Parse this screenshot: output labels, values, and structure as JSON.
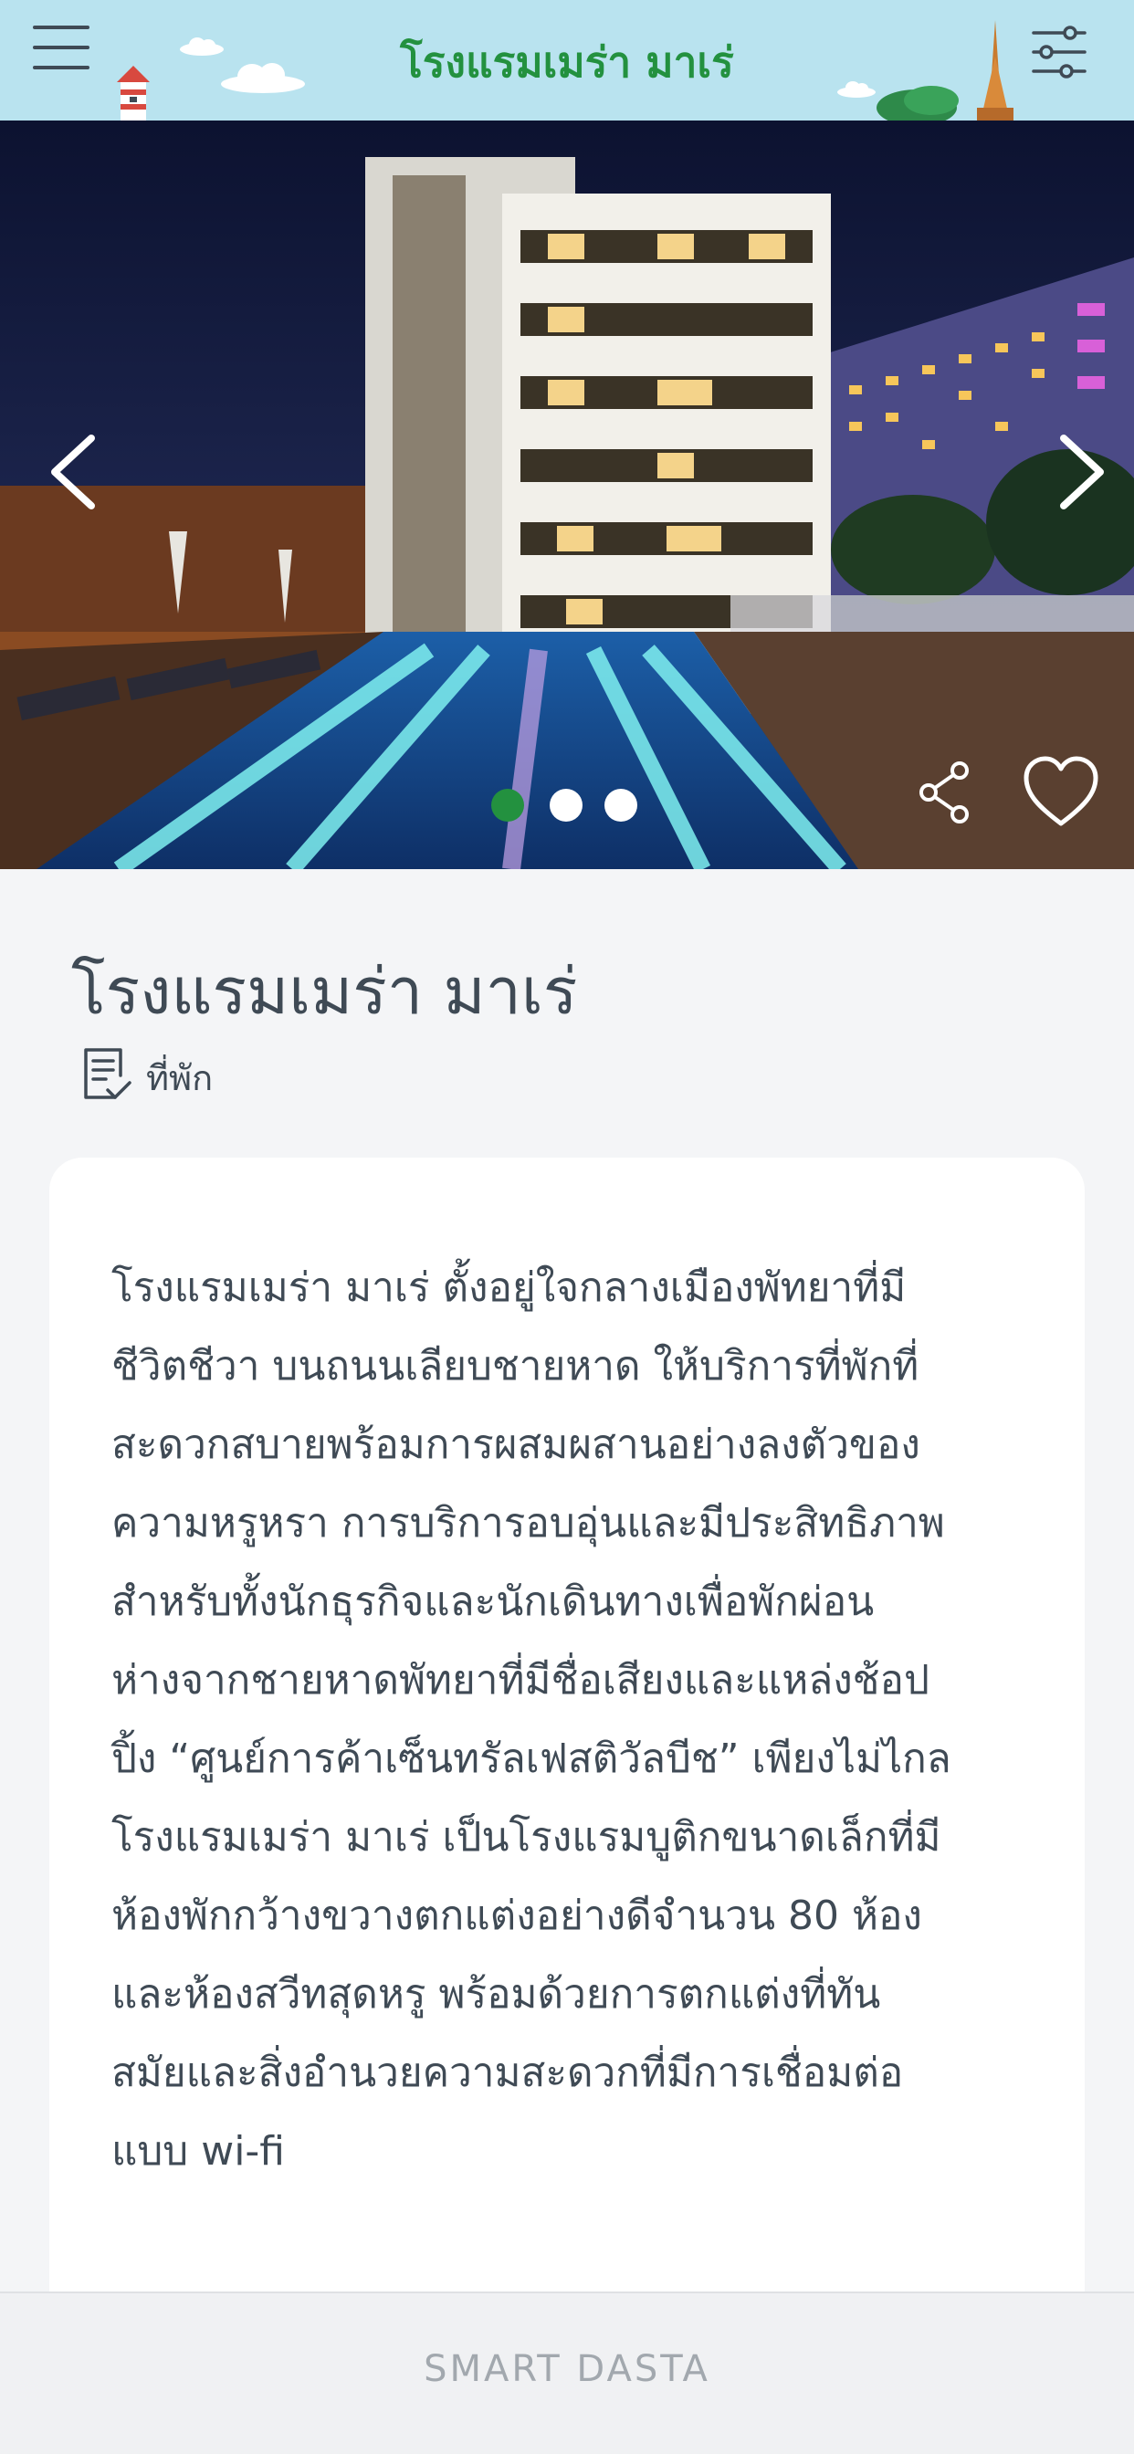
{
  "header": {
    "title": "โรงแรมเมร่า มาเร่",
    "menu_icon": "hamburger-menu-icon",
    "filter_icon": "sliders-icon"
  },
  "gallery": {
    "prev_icon": "chevron-left-icon",
    "next_icon": "chevron-right-icon",
    "slide_count": 3,
    "active_slide": 1,
    "share_icon": "share-icon",
    "favorite_icon": "heart-icon"
  },
  "place": {
    "title": "โรงแรมเมร่า มาเร่",
    "category_icon": "document-check-icon",
    "category": "ที่พัก"
  },
  "description": {
    "text": "โรงแรมเมร่า มาเร่ ตั้งอยู่ใจกลางเมืองพัทยาที่มี\nชีวิตชีวา บนถนนเลียบชายหาด ให้บริการที่พักที่\nสะดวกสบายพร้อมการผสมผสานอย่างลงตัวของ\nความหรูหรา การบริการอบอุ่นและมีประสิทธิภาพ\nสำหรับทั้งนักธุรกิจและนักเดินทางเพื่อพักผ่อน\nห่างจากชายหาดพัทยาที่มีชื่อเสียงและแหล่งช้อป\nปิ้ง “ศูนย์การค้าเซ็นทรัลเฟสติวัลบีช” เพียงไม่ไกล\nโรงแรมเมร่า มาเร่ เป็นโรงแรมบูติกขนาดเล็กที่มี\nห้องพักกว้างขวางตกแต่งอย่างดีจำนวน 80 ห้อง\nและห้องสวีทสุดหรู พร้อมด้วยการตกแต่งที่ทัน\nสมัยและสิ่งอำนวยความสะดวกที่มีการเชื่อมต่อ\nแบบ wi-fi"
  },
  "footer": {
    "brand": "SMART DASTA"
  },
  "colors": {
    "header_bg": "#b9e3ef",
    "accent_green": "#23913f",
    "text_dark": "#3f4a55",
    "footer_text": "#a2a8ae"
  }
}
